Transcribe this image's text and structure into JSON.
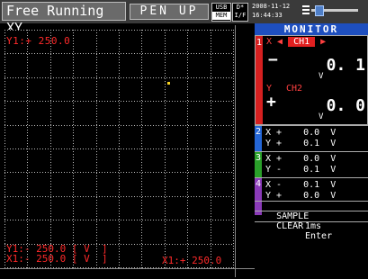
{
  "header": {
    "title": "Free Running XY",
    "pen_status": "PEN  UP",
    "usb_label": "USB",
    "mem_label": "MEM",
    "mini_top": "D*",
    "mini_bottom": "I/F",
    "date": "2008-11-12",
    "time": "16:44:33"
  },
  "graph": {
    "y1_top": "Y1:+ 250.0",
    "y1_bottom_line1": "Y1:- 250.0 [ V  ]",
    "y1_bottom_line2": "X1:- 250.0 [ V  ]",
    "x1_bottom": "X1:+ 250.0",
    "grid_color": "#bdbdbd",
    "pen_dot_color": "#f5d020"
  },
  "monitor": {
    "title": "MONITOR",
    "ch1": {
      "number": "1",
      "x_label": "X",
      "y_label": "Y",
      "x_channel": "CH1",
      "y_channel": "CH2",
      "x_sign": "−",
      "x_value": "0. 1",
      "x_unit": "V",
      "y_sign": "+",
      "y_value": "0. 0",
      "y_unit": "V"
    },
    "rows": [
      {
        "number": "2",
        "color": "#2466d6",
        "x": "X +    0.0  V",
        "y": "Y +    0.1  V"
      },
      {
        "number": "3",
        "color": "#2aa02a",
        "x": "X +    0.0  V",
        "y": "Y -    0.1  V"
      },
      {
        "number": "4",
        "color": "#8a3ab8",
        "x": "X -    0.1  V",
        "y": "Y +    0.0  V"
      }
    ],
    "sample_label": "SAMPLE",
    "sample_value": "1ms",
    "clear_label": "CLEAR",
    "clear_value": "Enter"
  },
  "icons": [
    "usb-mem-indicator",
    "interface-indicator",
    "scroll-slider"
  ],
  "accent_colors": {
    "monitor_header": "#1e4fbf",
    "ch1": "#d62020",
    "title_bg": "#6a6a6a"
  }
}
